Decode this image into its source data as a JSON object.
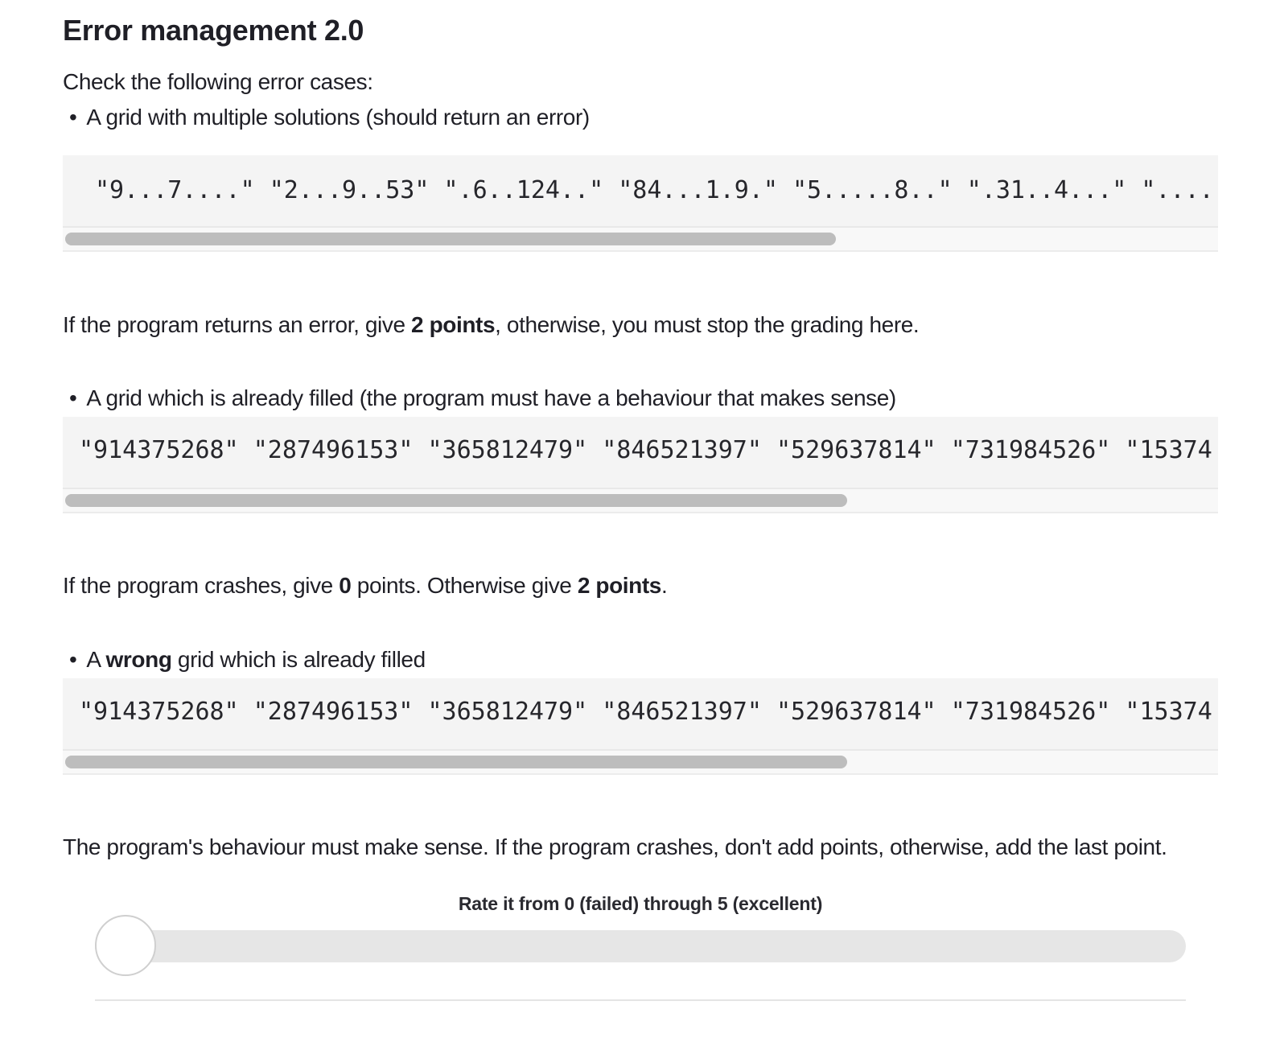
{
  "section": {
    "title": "Error management 2.0",
    "intro": "Check the following error cases:"
  },
  "cases": [
    {
      "bullet_text": "A grid with multiple solutions (should return an error)",
      "code": "\"9...7....\" \"2...9..53\" \".6..124..\" \"84...1.9.\" \"5.....8..\" \".31..4...\" \"....",
      "scroll_fraction": 0.67,
      "result": {
        "before": "If the program returns an error, give ",
        "bold1": "2 points",
        "middle": ", otherwise, you must stop the grading here.",
        "bold2": "",
        "after": ""
      }
    },
    {
      "bullet_text": "A grid which is already filled (the program must have a behaviour that makes sense)",
      "code": "\"914375268\" \"287496153\" \"365812479\" \"846521397\" \"529637814\" \"731984526\" \"15374",
      "scroll_fraction": 0.68,
      "result": {
        "before": "If the program crashes, give ",
        "bold1": "0",
        "middle": " points. Otherwise give ",
        "bold2": "2 points",
        "after": "."
      }
    },
    {
      "bullet_prefix": "A ",
      "bullet_bold": "wrong",
      "bullet_suffix": " grid which is already filled",
      "code": "\"914375268\" \"287496153\" \"365812479\" \"846521397\" \"529637814\" \"731984526\" \"15374",
      "scroll_fraction": 0.68,
      "result": {
        "text": "The program's behaviour must make sense. If the program crashes, don't add points, otherwise, add the last point."
      }
    }
  ],
  "rating": {
    "label": "Rate it from 0 (failed) through 5 (excellent)",
    "value": 0,
    "min": 0,
    "max": 5
  },
  "bullet_glyph": "•"
}
